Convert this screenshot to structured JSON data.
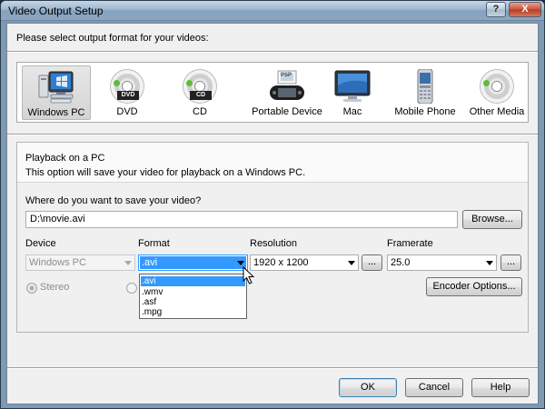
{
  "window": {
    "title": "Video Output Setup"
  },
  "prompt": "Please select output format for your videos:",
  "formats": [
    {
      "label": "Windows PC",
      "icon": "windows-pc-icon",
      "selected": true
    },
    {
      "label": "DVD",
      "icon": "dvd-disc-icon",
      "badge": "DVD"
    },
    {
      "label": "CD",
      "icon": "cd-disc-icon",
      "badge": "CD"
    },
    {
      "label": "Portable Device",
      "icon": "psp-device-icon",
      "badge": "PSP"
    },
    {
      "label": "Mac",
      "icon": "mac-monitor-icon"
    },
    {
      "label": "Mobile Phone",
      "icon": "mobile-phone-icon"
    },
    {
      "label": "Other Media",
      "icon": "other-media-disc-icon"
    }
  ],
  "panel": {
    "title": "Playback on a PC",
    "description": "This option will save your video for playback on a Windows PC.",
    "save_question": "Where do you want to save your video?",
    "save_path": "D:\\movie.avi",
    "browse_label": "Browse...",
    "device": {
      "label": "Device",
      "value": "Windows PC",
      "disabled": true
    },
    "format": {
      "label": "Format",
      "value": ".avi",
      "open": true,
      "options": [
        ".avi",
        ".wmv",
        ".asf",
        ".mpg"
      ]
    },
    "resolution": {
      "label": "Resolution",
      "value": "1920 x 1200",
      "more_label": "..."
    },
    "framerate": {
      "label": "Framerate",
      "value": "25.0",
      "more_label": "..."
    },
    "stereo_label": "Stereo",
    "encoder_options_label": "Encoder Options..."
  },
  "footer": {
    "ok_label": "OK",
    "cancel_label": "Cancel",
    "help_label": "Help"
  },
  "title_buttons": {
    "help": "?",
    "close": "X"
  },
  "colors": {
    "selection": "#3399ff",
    "title_gradient_top": "#c5d6e6",
    "close_red": "#c9533a"
  }
}
